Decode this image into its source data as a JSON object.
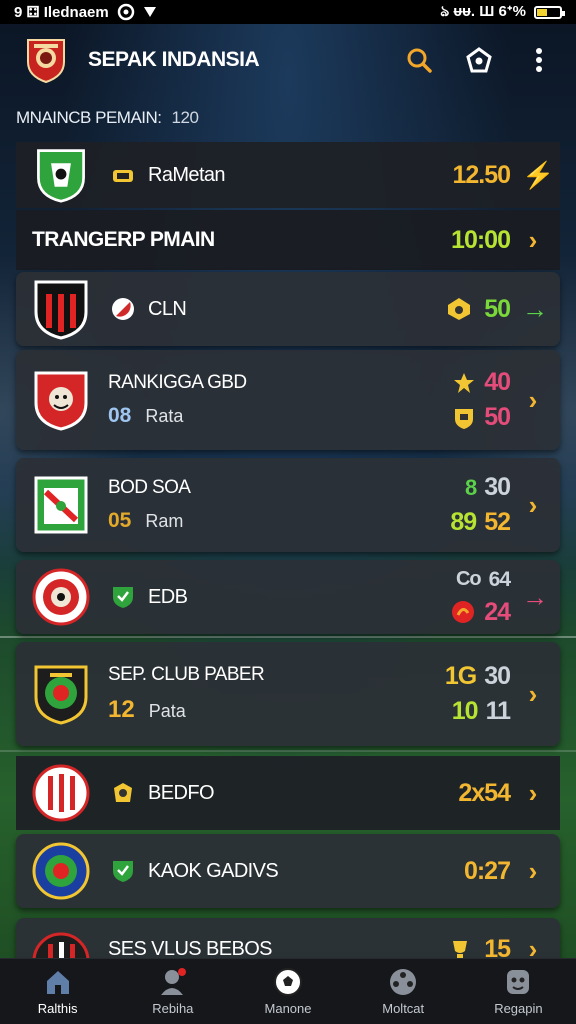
{
  "status_bar": {
    "left_text": "9 ⚃ Ilednaem",
    "right_text": "ঌ ᵾᵾ. Ш 6ᐩ%",
    "battery_fill": 0.45
  },
  "app_bar": {
    "title": "SEPAK INDANSIA",
    "actions": [
      "search-icon",
      "share-icon",
      "more-icon"
    ]
  },
  "section": {
    "label": "MNAINCB PEMAIN:",
    "count": "120"
  },
  "rows": [
    {
      "name": "RaMetan",
      "score": "12.50",
      "score_color": "#f2b630",
      "arrow": "⚡",
      "arrow_color": "#f08a24"
    },
    {
      "name": "TRANGERP PMAIN",
      "score": "10:00",
      "score_color": "#b7e332",
      "arrow": "›",
      "arrow_color": "#f2b630"
    },
    {
      "name": "CLN",
      "score": "50",
      "score_color": "#7ad83a",
      "arrow": "→",
      "arrow_color": "#5bd24a"
    },
    {
      "name": "RANKIGGA GBD",
      "sub_num": "08",
      "sub_num_color": "#9fc6f0",
      "sub_text": "Rata",
      "top": "40",
      "top_color": "#e54c7a",
      "bottom": "50",
      "bottom_color": "#e54c7a",
      "arrow": "›",
      "arrow_color": "#f2b630"
    },
    {
      "name": "BOD SOA",
      "sub_num": "05",
      "sub_num_color": "#e3a92a",
      "sub_text": "Ram",
      "top": "30",
      "top_color": "#cdd3da",
      "bottom": "52",
      "bottom_color": "#f2b630",
      "left_top": "8",
      "left_bottom": "89",
      "arrow": "›",
      "arrow_color": "#f2b630"
    },
    {
      "name": "EDB",
      "top": "64",
      "top_color": "#cdd3da",
      "bottom": "24",
      "bottom_color": "#e54c7a",
      "left_top": "Co",
      "arrow": "→",
      "arrow_color": "#e54c7a"
    },
    {
      "name": "SEP. CLUB PABER",
      "sub_num": "12",
      "sub_num_color": "#f2b630",
      "sub_text": "Pata",
      "top": "30",
      "top_color": "#cdd3da",
      "bottom": "11",
      "bottom_color": "#cdd3da",
      "left_top": "1G",
      "left_bottom": "10",
      "arrow": "›",
      "arrow_color": "#f2b630"
    },
    {
      "name": "BEDFO",
      "score": "2x54",
      "score_color": "#f2b630",
      "arrow": "›",
      "arrow_color": "#f2b630"
    },
    {
      "name": "KAOK GADIVS",
      "score": "0:27",
      "score_color": "#f2b630",
      "arrow": "›",
      "arrow_color": "#f2b630"
    },
    {
      "name": "SES VLUS BEBOS",
      "score": "15",
      "score_color": "#f2b630",
      "arrow": "›",
      "arrow_color": "#f2b630"
    }
  ],
  "bottom_nav": [
    {
      "label": "Ralthis",
      "icon": "home-icon"
    },
    {
      "label": "Rebiha",
      "icon": "player-icon"
    },
    {
      "label": "Manone",
      "icon": "ball-icon"
    },
    {
      "label": "Moltcat",
      "icon": "film-icon"
    },
    {
      "label": "Regapin",
      "icon": "profile-icon"
    }
  ]
}
